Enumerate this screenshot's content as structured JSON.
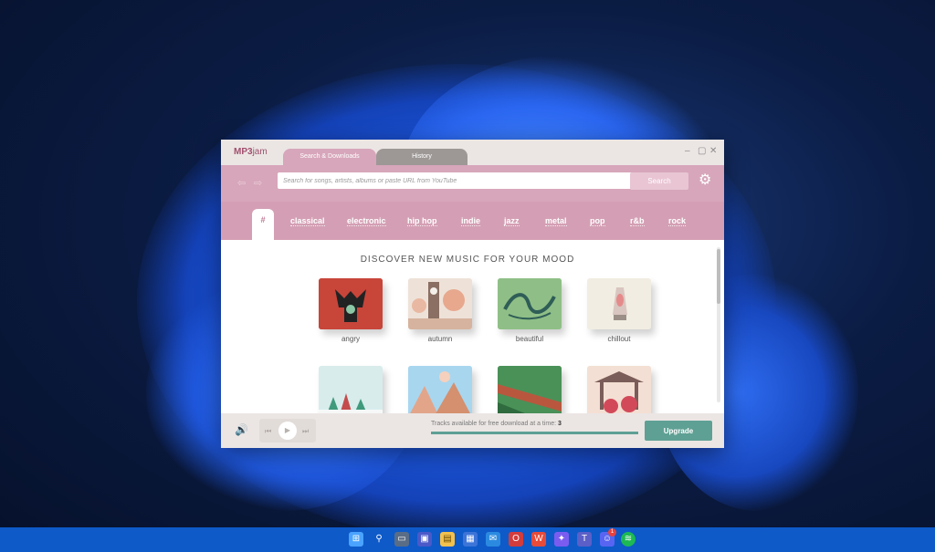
{
  "app": {
    "logo_prefix": "MP3",
    "logo_suffix": "jam",
    "tabs": [
      {
        "label": "Search & Downloads",
        "active": true
      },
      {
        "label": "History",
        "active": false
      }
    ],
    "window_controls": [
      "–",
      "▢",
      "✕"
    ]
  },
  "search": {
    "placeholder": "Search for songs, artists, albums or paste URL from YouTube",
    "button_label": "Search",
    "back_icon": "⇦",
    "forward_icon": "⇨",
    "settings_icon": "⚙"
  },
  "genres": {
    "active": "#",
    "items": [
      "classical",
      "electronic",
      "hip hop",
      "indie",
      "jazz",
      "metal",
      "pop",
      "r&b",
      "rock"
    ]
  },
  "discover": {
    "heading": "DISCOVER NEW MUSIC FOR YOUR MOOD",
    "moods": [
      "angry",
      "autumn",
      "beautiful",
      "chillout"
    ]
  },
  "footer": {
    "volume_icon": "🔊",
    "prev_icon": "⏮",
    "play_icon": "▶",
    "next_icon": "⏭",
    "tracks_text": "Tracks available for free download at a time:",
    "tracks_count": "3",
    "upgrade_label": "Upgrade"
  },
  "taskbar": {
    "badge_count": "1"
  },
  "colors": {
    "accent_pink": "#d7a6ba",
    "accent_teal": "#5fa094",
    "taskbar": "#0e5ac9"
  }
}
